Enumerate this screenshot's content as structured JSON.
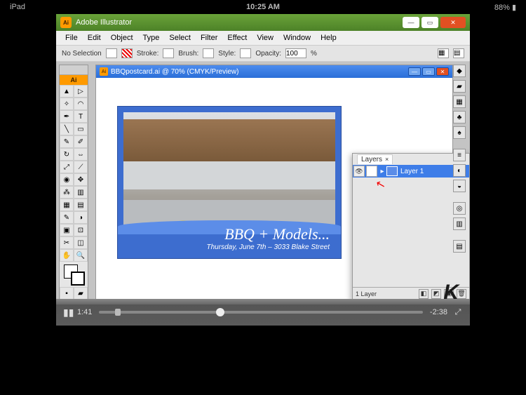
{
  "ipad": {
    "device": "iPad",
    "time": "10:25 AM",
    "battery": "88%"
  },
  "app": {
    "name": "Adobe Illustrator",
    "icon": "Ai"
  },
  "menu": [
    "File",
    "Edit",
    "Object",
    "Type",
    "Select",
    "Filter",
    "Effect",
    "View",
    "Window",
    "Help"
  ],
  "options": {
    "selection": "No Selection",
    "stroke_label": "Stroke:",
    "brush_label": "Brush:",
    "style_label": "Style:",
    "opacity_label": "Opacity:",
    "opacity_value": "100",
    "opacity_unit": "%"
  },
  "doc": {
    "title": "BBQpostcard.ai @ 70% (CMYK/Preview)",
    "zoom": "70%",
    "postcard_heading": "BBQ + Models...",
    "postcard_sub": "Thursday, June 7th – 3033 Blake Street"
  },
  "layers": {
    "panel_title": "Layers",
    "layer1": "Layer 1",
    "footer_count": "1 Layer"
  },
  "video": {
    "elapsed": "1:41",
    "remaining": "-2:38"
  }
}
